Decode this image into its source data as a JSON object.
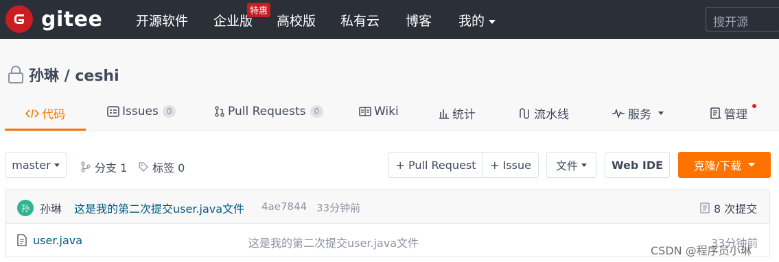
{
  "header": {
    "logo_text": "gitee",
    "nav": [
      "开源软件",
      "企业版",
      "高校版",
      "私有云",
      "博客",
      "我的"
    ],
    "hot_badge": "特惠",
    "search_placeholder": "搜开源"
  },
  "repo": {
    "title": "孙琳 / ceshi"
  },
  "tabs": [
    {
      "label": "代码",
      "active": true
    },
    {
      "label": "Issues",
      "count": "0"
    },
    {
      "label": "Pull Requests",
      "count": "0"
    },
    {
      "label": "Wiki"
    },
    {
      "label": "统计"
    },
    {
      "label": "流水线"
    },
    {
      "label": "服务"
    },
    {
      "label": "管理"
    }
  ],
  "toolbar": {
    "branch": "master",
    "branches": "分支 1",
    "tags": "标签 0",
    "pull_request": "+ Pull Request",
    "issue": "+ Issue",
    "files": "文件",
    "web_ide": "Web IDE",
    "clone": "克隆/下载"
  },
  "commit": {
    "avatar": "孙",
    "author": "孙琳",
    "message": "这是我的第二次提交user.java文件",
    "hash": "4ae7844",
    "time": "33分钟前",
    "count": "8 次提交"
  },
  "files": [
    {
      "name": "user.java",
      "message": "这是我的第二次提交user.java文件",
      "time": "33分钟前"
    }
  ],
  "watermark": "CSDN @程序员小琳",
  "colors": {
    "accent": "#fe7300",
    "topbar": "#2a2f38",
    "brand": "#c71d23",
    "link": "#005980"
  }
}
